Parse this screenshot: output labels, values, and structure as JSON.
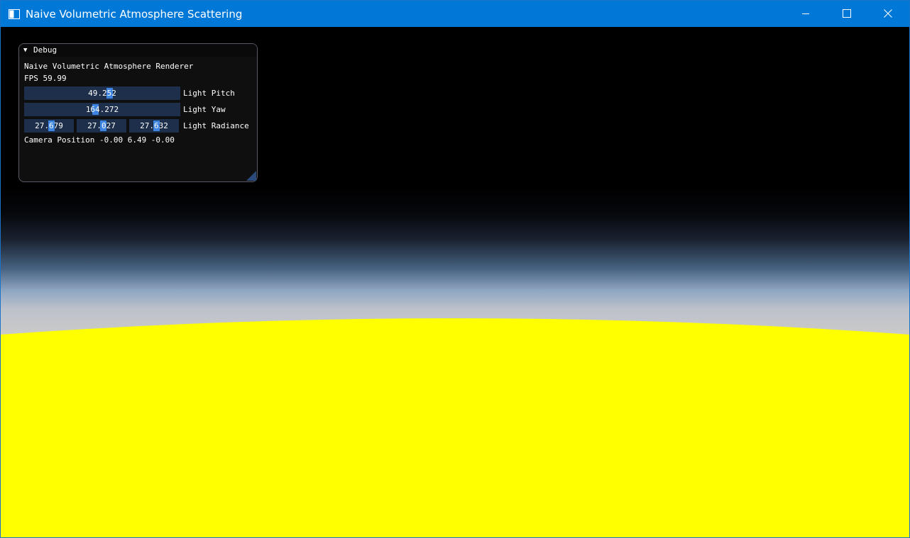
{
  "window": {
    "title": "Naive Volumetric Atmosphere Scattering",
    "accent_color": "#0078d7",
    "icons": {
      "app": "app-window-icon",
      "minimize": "minimize-icon",
      "maximize": "maximize-icon",
      "close": "close-icon"
    }
  },
  "scene": {
    "space_color": "#000000",
    "haze_color": "#c9c9c9",
    "planet_color": "#ffff00"
  },
  "debug": {
    "title": "Debug",
    "collapse_icon": "collapse-triangle-icon",
    "heading": "Naive Volumetric Atmosphere Renderer",
    "fps": "FPS 59.99",
    "light_pitch": {
      "value": "49.252",
      "label": "Light Pitch"
    },
    "light_yaw": {
      "value": "164.272",
      "label": "Light Yaw"
    },
    "light_radiance": {
      "values": [
        "27.679",
        "27.027",
        "27.632"
      ],
      "label": "Light Radiance"
    },
    "camera_position": "Camera Position -0.00 6.49 -0.00",
    "slider_color": "#1d2f4a",
    "grab_color": "#3d85e0"
  }
}
